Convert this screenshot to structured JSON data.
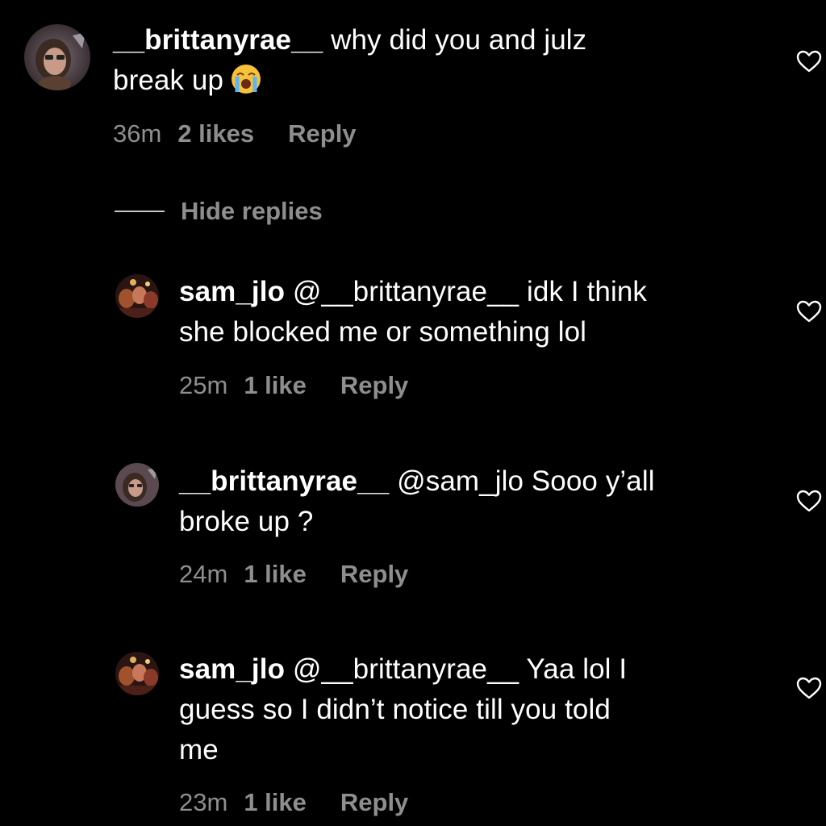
{
  "comments": [
    {
      "username": "__brittanyrae__",
      "text": " why did you and julz",
      "text2": "break up",
      "emoji": "loudly-crying-face-emoji",
      "time": "36m",
      "likes": "2 likes",
      "reply": "Reply"
    },
    {
      "username": "sam_jlo",
      "mention": " @__brittanyrae__",
      "text": " idk I think",
      "text2": "she blocked me or something lol",
      "time": "25m",
      "likes": "1 like",
      "reply": "Reply"
    },
    {
      "username": "__brittanyrae__",
      "mention": " @sam_jlo",
      "text": " Sooo y’all",
      "text2": "broke up ?",
      "time": "24m",
      "likes": "1 like",
      "reply": "Reply"
    },
    {
      "username": "sam_jlo",
      "mention": " @__brittanyrae__",
      "text": " Yaa lol I",
      "text2": "guess so I didn’t notice till you told",
      "text3": "me",
      "time": "23m",
      "likes": "1 like",
      "reply": "Reply"
    }
  ],
  "hide_replies_label": "Hide replies",
  "icons": {
    "like": "heart-outline-icon",
    "avatar_brittany": "profile-photo-brittanyrae",
    "avatar_sam": "profile-photo-sam-jlo"
  },
  "colors": {
    "background": "#000000",
    "text": "#ffffff",
    "secondary": "#8e8e8e"
  }
}
